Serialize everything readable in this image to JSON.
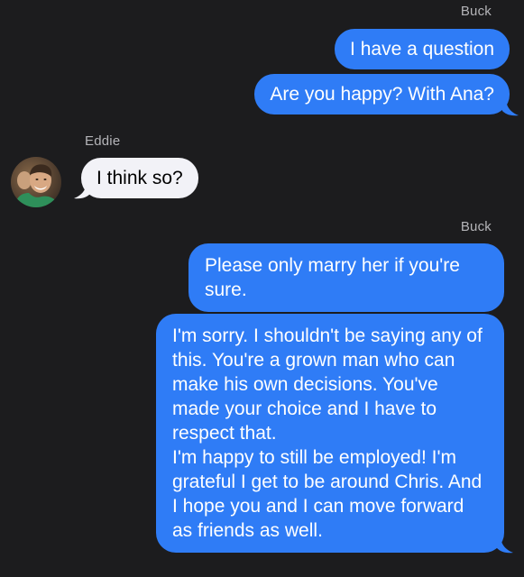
{
  "conversation": {
    "group1": {
      "sender": "Buck",
      "messages": [
        "I have a question",
        "Are you happy? With Ana?"
      ]
    },
    "group2": {
      "sender": "Eddie",
      "avatar": "person-avatar",
      "messages": [
        "I think so?"
      ]
    },
    "group3": {
      "sender": "Buck",
      "messages": [
        "Please only marry her if you're sure.",
        "I'm sorry. I shouldn't be saying any of this. You're a grown man who can make his own decisions. You've made your choice and I have to respect that.\nI'm happy to still be employed! I'm grateful I get to be around Chris. And I hope you and I can move forward as friends as well."
      ]
    }
  },
  "colors": {
    "background": "#1c1c1e",
    "outgoing_bubble": "#2f7cf6",
    "incoming_bubble": "#f2f2f7",
    "sender_name": "#b4b4b8"
  }
}
